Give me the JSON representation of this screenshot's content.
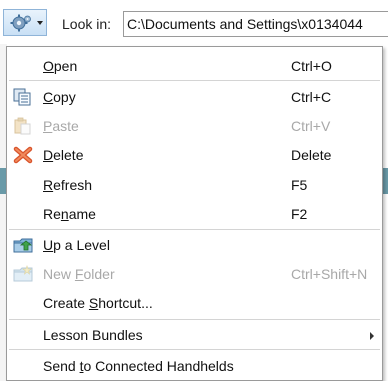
{
  "toolbar": {
    "gear_icon": "gear-icon",
    "lookin_label": "Look in:",
    "lookin_path": "C:\\Documents and Settings\\x0134044"
  },
  "menu": {
    "items": [
      {
        "label": "Open",
        "mnemonic": "O",
        "shortcut": "Ctrl+O",
        "enabled": true,
        "icon": ""
      },
      {
        "label": "Copy",
        "mnemonic": "C",
        "shortcut": "Ctrl+C",
        "enabled": true,
        "icon": "copy-icon"
      },
      {
        "label": "Paste",
        "mnemonic": "P",
        "shortcut": "Ctrl+V",
        "enabled": false,
        "icon": "paste-icon"
      },
      {
        "label": "Delete",
        "mnemonic": "D",
        "shortcut": "Delete",
        "enabled": true,
        "icon": "delete-icon"
      },
      {
        "label": "Refresh",
        "mnemonic": "R",
        "shortcut": "F5",
        "enabled": true,
        "icon": ""
      },
      {
        "label": "Rename",
        "mnemonic": "n",
        "shortcut": "F2",
        "enabled": true,
        "icon": ""
      },
      {
        "label": "Up a Level",
        "mnemonic": "U",
        "shortcut": "",
        "enabled": true,
        "icon": "up-level-icon"
      },
      {
        "label": "New Folder",
        "mnemonic": "F",
        "shortcut": "Ctrl+Shift+N",
        "enabled": false,
        "icon": "new-folder-icon"
      },
      {
        "label": "Create Shortcut...",
        "mnemonic": "S",
        "shortcut": "",
        "enabled": true,
        "icon": ""
      },
      {
        "label": "Lesson Bundles",
        "mnemonic": "",
        "shortcut": "",
        "enabled": true,
        "icon": "",
        "submenu": true
      },
      {
        "label": "Send to Connected Handhelds",
        "mnemonic": "t",
        "shortcut": "",
        "enabled": true,
        "icon": ""
      }
    ]
  },
  "colors": {
    "menu_border": "#9a9a9a",
    "disabled_text": "#a8a8a8",
    "separator": "#d4d4d4"
  }
}
